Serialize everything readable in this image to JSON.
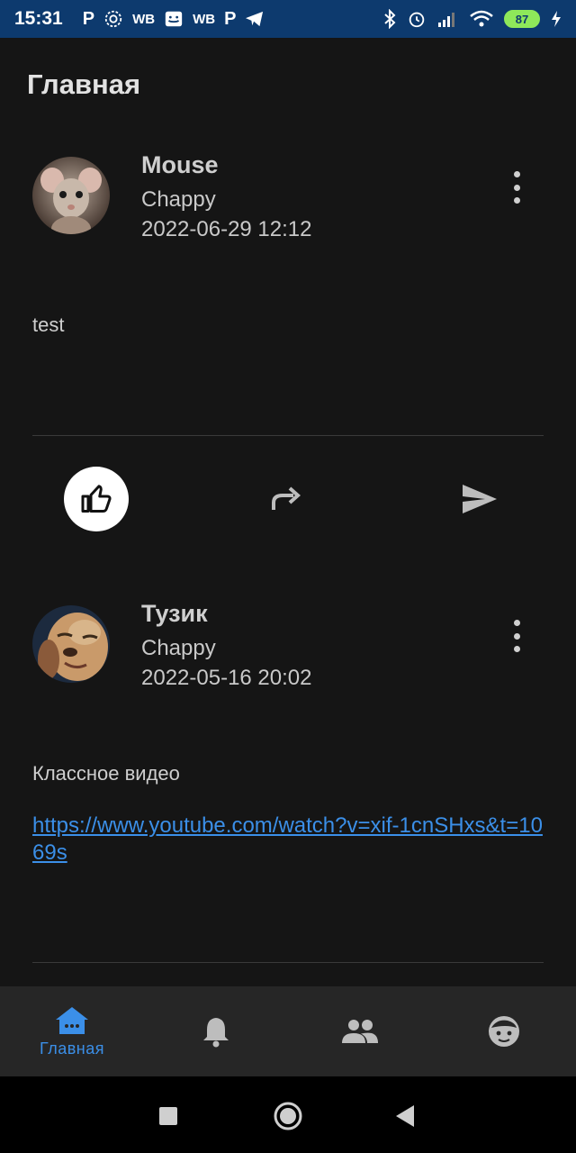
{
  "status_bar": {
    "time": "15:31",
    "left_icons": [
      "P",
      "gear",
      "WB",
      "cat",
      "WB",
      "P",
      "telegram"
    ],
    "battery": "87"
  },
  "page": {
    "title": "Главная"
  },
  "posts": [
    {
      "author": "Mouse",
      "group": "Chappy",
      "date": "2022-06-29 12:12",
      "text": "test",
      "avatar": "mouse-photo"
    },
    {
      "author": "Тузик",
      "group": "Chappy",
      "date": "2022-05-16 20:02",
      "text": "Классное видео",
      "link": "https://www.youtube.com/watch?v=xif-1cnSHxs&t=1069s",
      "avatar": "dog-photo"
    }
  ],
  "nav": {
    "items": [
      {
        "label": "Главная",
        "icon": "home-icon",
        "active": true
      },
      {
        "label": "",
        "icon": "bell-icon",
        "active": false
      },
      {
        "label": "",
        "icon": "people-icon",
        "active": false
      },
      {
        "label": "",
        "icon": "face-icon",
        "active": false
      }
    ]
  },
  "colors": {
    "accent": "#3b8fe8",
    "background": "#151515",
    "statusbar": "#0d3a6e"
  }
}
